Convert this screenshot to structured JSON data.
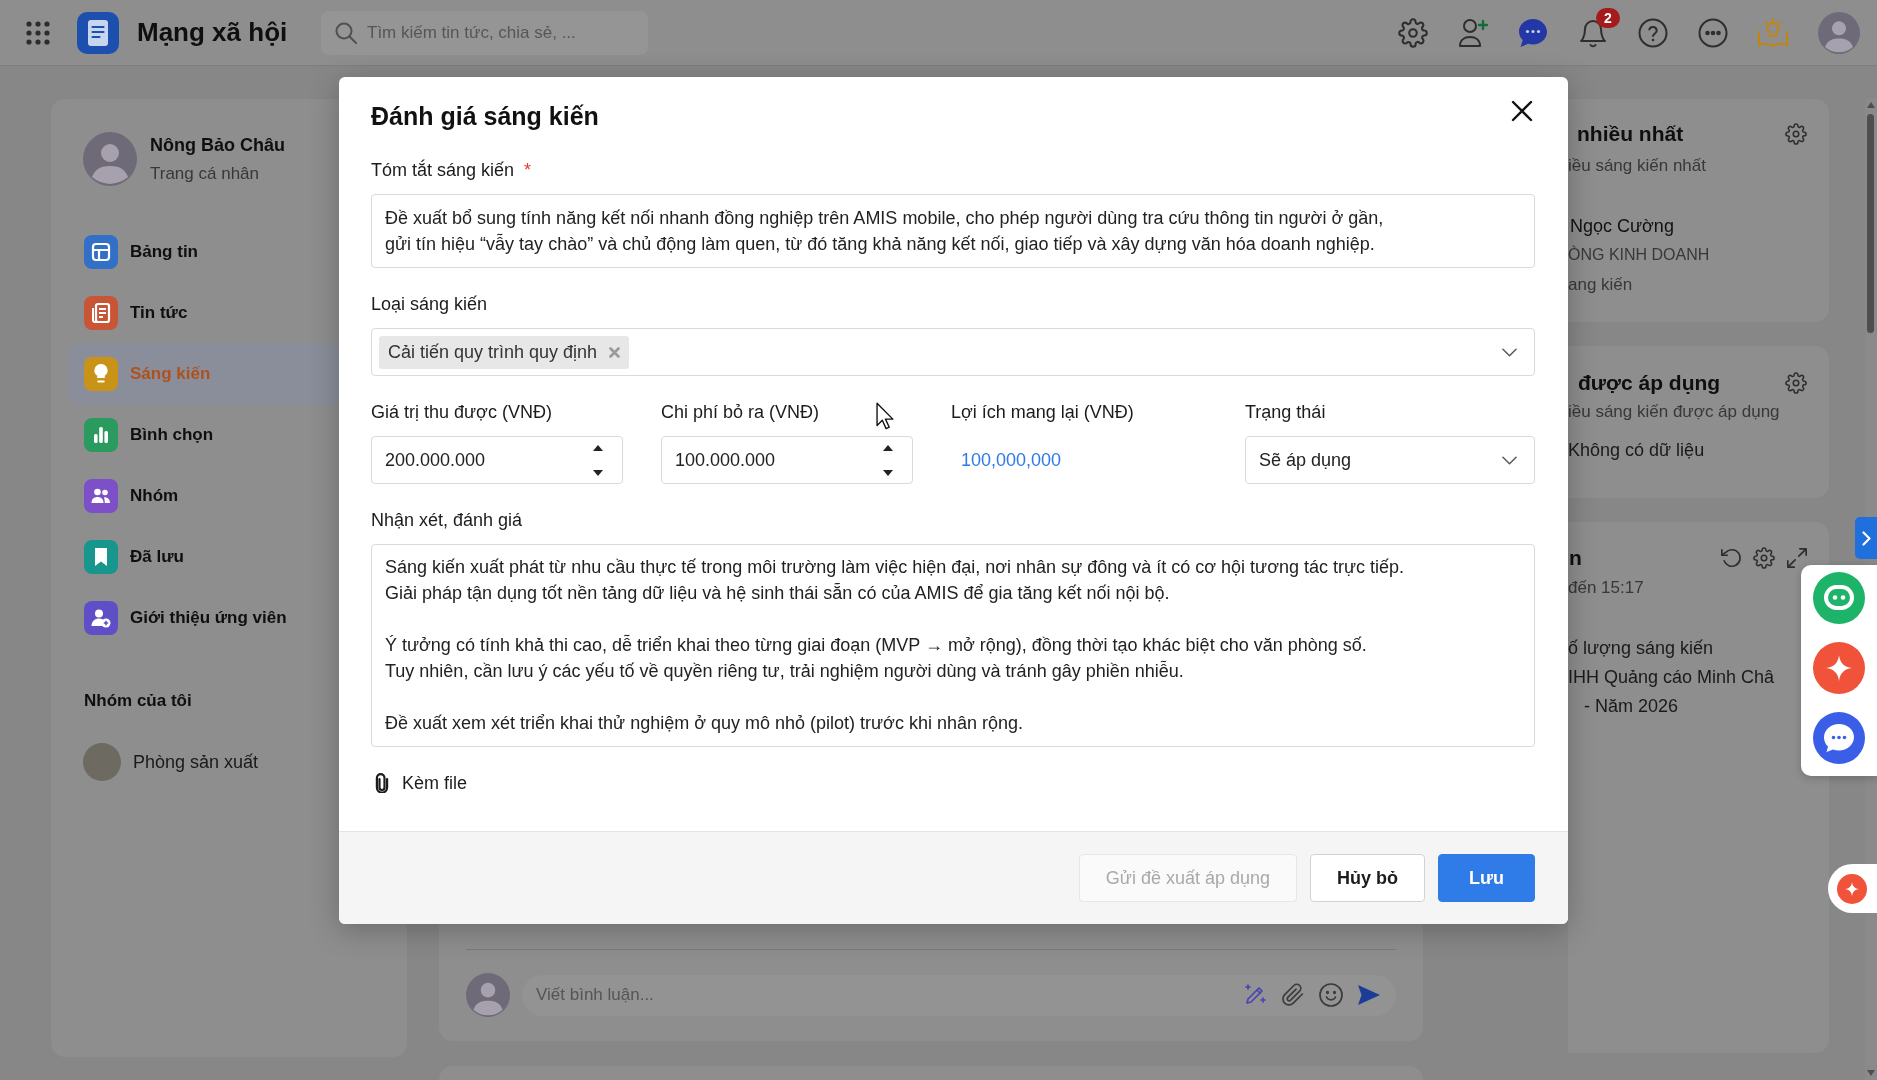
{
  "top_bar": {
    "app_title": "Mạng xã hội",
    "search": {
      "placeholder": "Tìm kiếm tin tức, chia sẻ, ..."
    },
    "notification_count": "2"
  },
  "sidebar": {
    "profile": {
      "name": "Nông Bảo Châu",
      "subtitle": "Trang cá nhân"
    },
    "items": [
      {
        "kind": "feed",
        "label": "Bảng tin",
        "color": "#3270c8",
        "selected": false
      },
      {
        "kind": "news",
        "label": "Tin tức",
        "color": "#c85636",
        "selected": false
      },
      {
        "kind": "idea",
        "label": "Sáng kiến",
        "color": "#c99317",
        "selected": true
      },
      {
        "kind": "poll",
        "label": "Bình chọn",
        "color": "#2a9a5e",
        "selected": false
      },
      {
        "kind": "group",
        "label": "Nhóm",
        "color": "#7d50c8",
        "selected": false
      },
      {
        "kind": "saved",
        "label": "Đã lưu",
        "color": "#16968c",
        "selected": false
      },
      {
        "kind": "referral",
        "label": "Giới thiệu ứng viên",
        "color": "#5e4fc6",
        "selected": false
      }
    ],
    "groups_heading": "Nhóm của tôi",
    "groups": [
      {
        "name": "Phòng sản xuất"
      }
    ]
  },
  "feed": {
    "comment": {
      "placeholder": "Viết bình luận..."
    }
  },
  "right_panel": {
    "top_card": {
      "title": "nhiều nhất",
      "subtitle": "iều sáng kiến nhất",
      "person_name": "Ngọc Cường",
      "department": "ÒNG KINH DOANH",
      "count_text": "ang kiến"
    },
    "applied_card": {
      "title": "được áp dụng",
      "subtitle": "iều sáng kiến được áp dụng",
      "empty_text": "Không có dữ liệu"
    },
    "stats_card": {
      "title": "n",
      "subtitle": "đến 15:17",
      "chart_title_lines": [
        "ố lượng sáng kiến",
        "IHH Quảng cáo Minh Châ",
        "- Năm 2026"
      ]
    }
  },
  "modal": {
    "title": "Đánh giá sáng kiến",
    "summary": {
      "label": "Tóm tắt sáng kiến",
      "required_mark": "*",
      "value": "Đề xuất bổ sung tính năng kết nối nhanh đồng nghiệp trên AMIS mobile, cho phép người dùng tra cứu thông tin người ở gần,\ngửi tín hiệu “vẫy tay chào” và chủ động làm quen, từ đó tăng khả năng kết nối, giao tiếp và xây dựng văn hóa doanh nghiệp."
    },
    "category": {
      "label": "Loại sáng kiến",
      "tags": [
        {
          "label": "Cải tiến quy trình quy định"
        }
      ]
    },
    "fields": [
      {
        "kind": "number",
        "label": "Giá trị thu được (VNĐ)",
        "value": "200.000.000"
      },
      {
        "kind": "number",
        "label": "Chi phí bỏ ra (VNĐ)",
        "value": "100.000.000"
      },
      {
        "kind": "computed",
        "label": "Lợi ích mang lại (VNĐ)",
        "value": "100,000,000"
      },
      {
        "kind": "select",
        "label": "Trạng thái",
        "value": "Sẽ áp dụng"
      }
    ],
    "review": {
      "label": "Nhận xét, đánh giá",
      "value": "Sáng kiến xuất phát từ nhu cầu thực tế trong môi trường làm việc hiện đại, nơi nhân sự đông và ít có cơ hội tương tác trực tiếp.\nGiải pháp tận dụng tốt nền tảng dữ liệu và hệ sinh thái sẵn có của AMIS để gia tăng kết nối nội bộ.\n\nÝ tưởng có tính khả thi cao, dễ triển khai theo từng giai đoạn (MVP → mở rộng), đồng thời tạo khác biệt cho văn phòng số.\nTuy nhiên, cần lưu ý các yếu tố về quyền riêng tư, trải nghiệm người dùng và tránh gây phiền nhiễu.\n\nĐề xuất xem xét triển khai thử nghiệm ở quy mô nhỏ (pilot) trước khi nhân rộng."
    },
    "attachment": {
      "label": "Kèm file"
    },
    "buttons": [
      {
        "kind": "submit",
        "label": "Gửi đề xuất áp dụng",
        "disabled": true
      },
      {
        "kind": "cancel",
        "label": "Hủy bỏ",
        "disabled": false
      },
      {
        "kind": "save",
        "label": "Lưu",
        "disabled": false
      }
    ]
  }
}
